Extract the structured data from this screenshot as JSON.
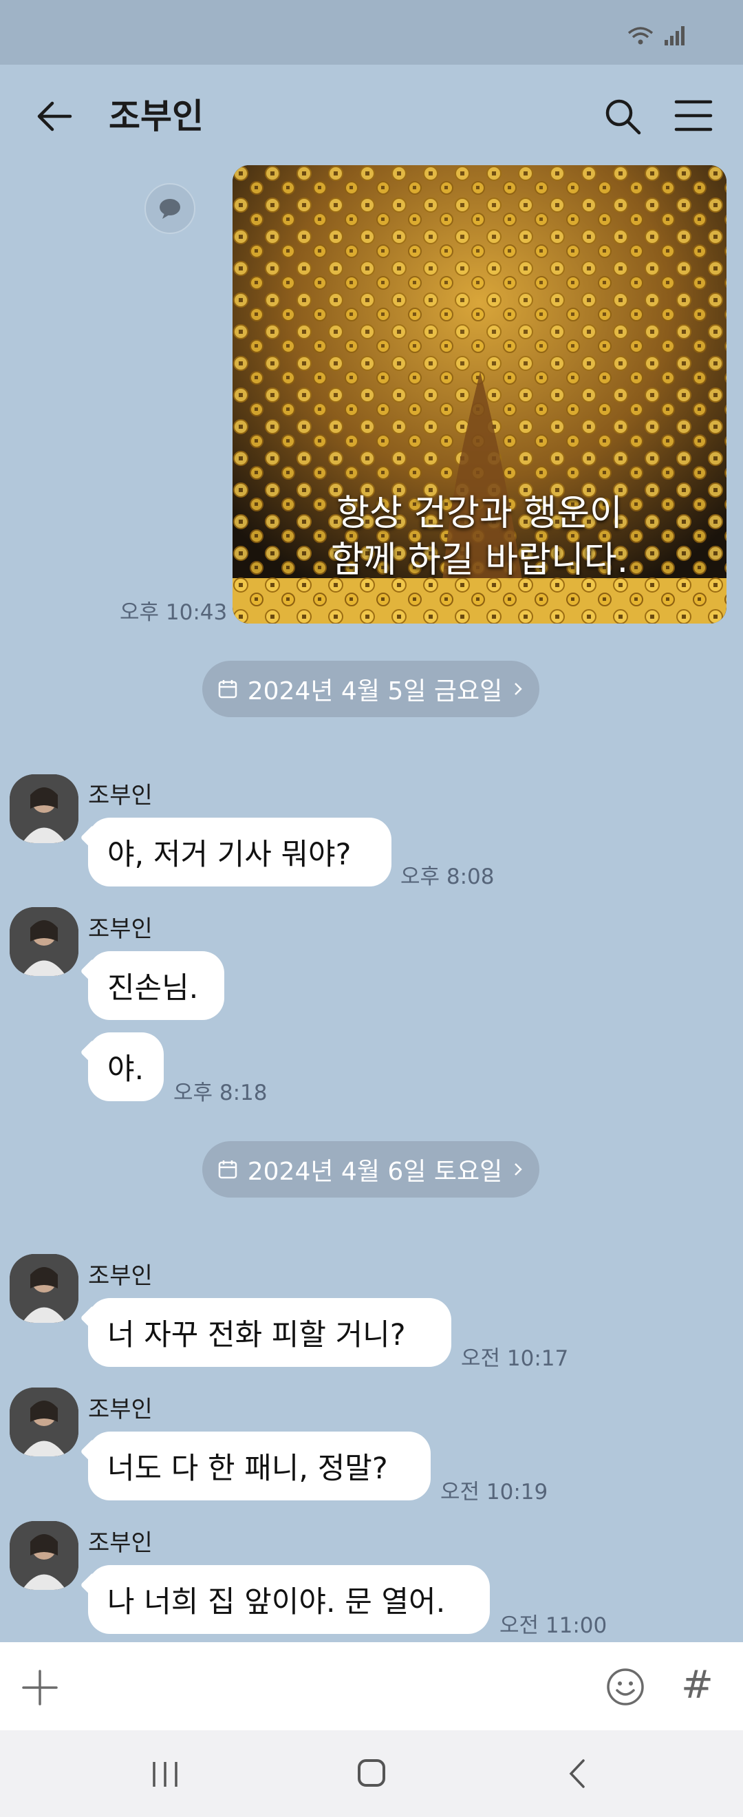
{
  "header": {
    "title": "조부인"
  },
  "image_message": {
    "caption_line1": "항상 건강과 행운이",
    "caption_line2": "함께 하길 바랍니다.",
    "time": "오후 10:43"
  },
  "dates": [
    "2024년 4월 5일 금요일",
    "2024년 4월 6일 토요일"
  ],
  "messages": [
    {
      "sender": "조부인",
      "text": "야, 저거 기사 뭐야?",
      "time": "오후 8:08"
    },
    {
      "sender": "조부인",
      "text": "진손님."
    },
    {
      "text": "야.",
      "time": "오후 8:18"
    },
    {
      "sender": "조부인",
      "text": "너 자꾸 전화 피할 거니?",
      "time": "오전 10:17"
    },
    {
      "sender": "조부인",
      "text": "너도 다 한 패니, 정말?",
      "time": "오전 10:19"
    },
    {
      "sender": "조부인",
      "text": "나 너희 집 앞이야. 문 열어.",
      "time": "오전 11:00"
    }
  ],
  "input": {
    "hash_label": "#"
  },
  "icons": {
    "back": "arrow-left-icon",
    "search": "search-icon",
    "menu": "hamburger-menu-icon",
    "share": "speech-bubble-icon",
    "calendar": "calendar-icon",
    "chevron": "chevron-right-icon",
    "plus": "plus-icon",
    "emoji": "smiley-icon",
    "wifi": "wifi-icon",
    "signal": "signal-icon"
  },
  "colors": {
    "chat_background": "#b2c7da",
    "bubble": "#ffffff",
    "date_pill": "#9daec0"
  }
}
